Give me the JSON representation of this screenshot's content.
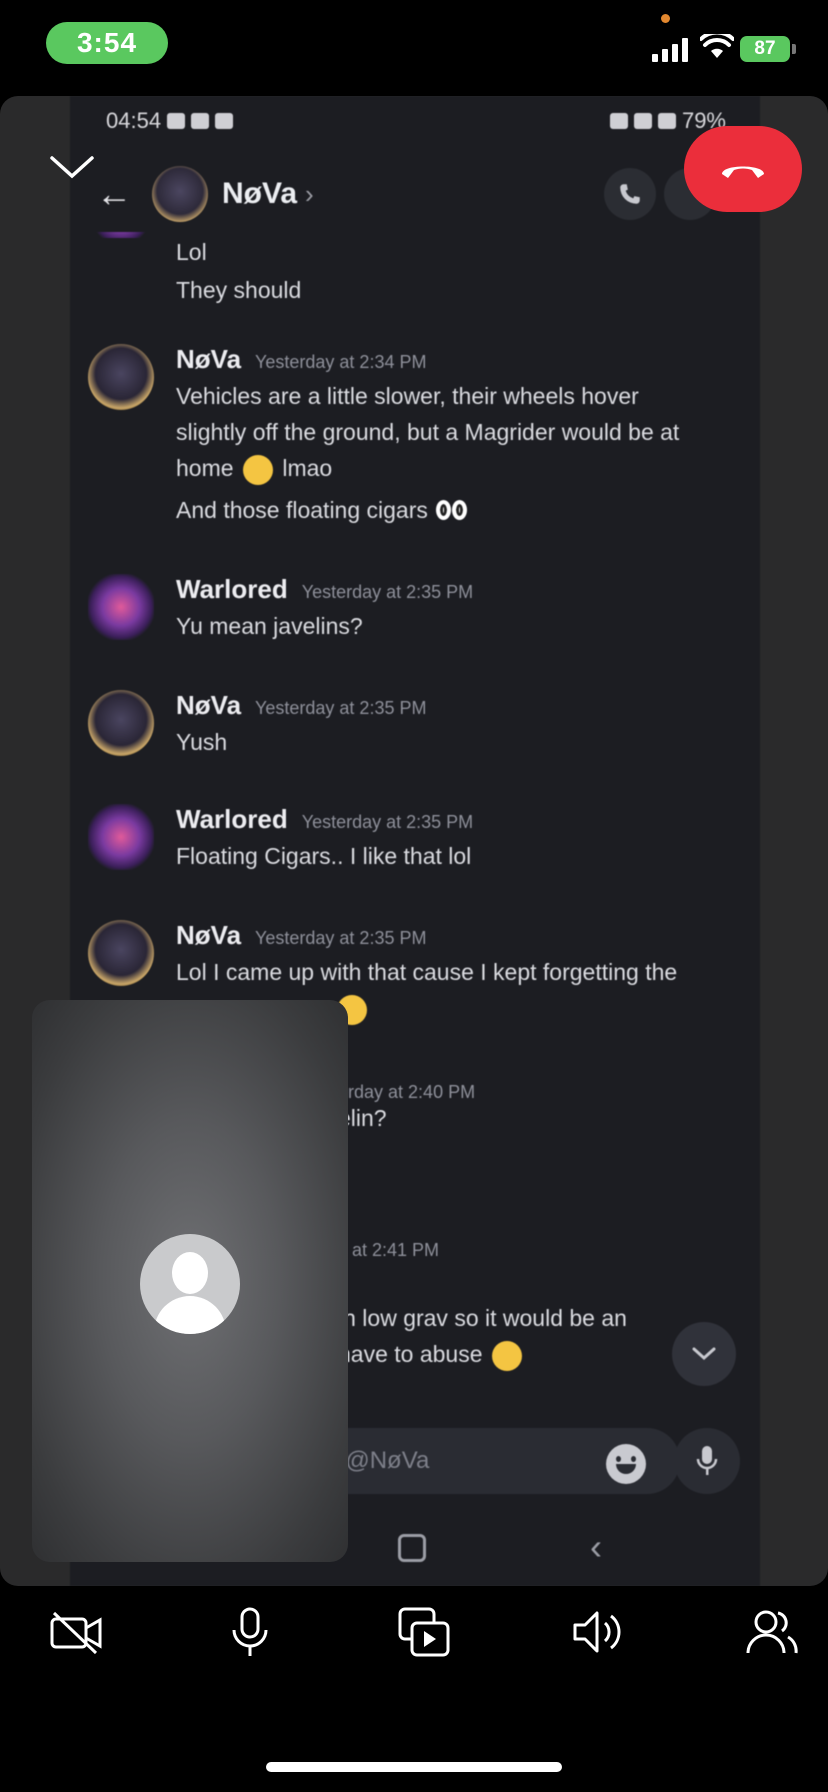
{
  "ios_status": {
    "time": "3:54",
    "battery": "87"
  },
  "shared_screen": {
    "android_status": {
      "time": "04:54",
      "battery": "79%"
    },
    "header": {
      "contact_name": "NøVa"
    },
    "messages": [
      {
        "author": "",
        "time": "",
        "lines": [
          "Lol",
          "They should"
        ]
      },
      {
        "author": "NøVa",
        "time": "Yesterday at 2:34 PM",
        "lines": [
          "Vehicles are a little slower, their wheels hover",
          "slightly off the ground, but a Magrider would be at",
          "home",
          "lmao",
          "And those floating cigars"
        ]
      },
      {
        "author": "Warlored",
        "time": "Yesterday at 2:35 PM",
        "lines": [
          "Yu mean javelins?"
        ]
      },
      {
        "author": "NøVa",
        "time": "Yesterday at 2:35 PM",
        "lines": [
          "Yush"
        ]
      },
      {
        "author": "Warlored",
        "time": "Yesterday at 2:35 PM",
        "lines": [
          "Floating Cigars.. I like that lol"
        ]
      },
      {
        "author": "NøVa",
        "time": "Yesterday at 2:35 PM",
        "lines": [
          "Lol I came up with that cause I kept forgetting the"
        ]
      },
      {
        "time_fragment": "erday at 2:40 PM",
        "line_fragment": "elin?"
      },
      {
        "time_fragment": "y at 2:41 PM",
        "line_fragments": [
          "in low grav so it would be an",
          "have to abuse"
        ]
      }
    ],
    "composer": {
      "placeholder_fragment": "ge @NøVa"
    }
  }
}
